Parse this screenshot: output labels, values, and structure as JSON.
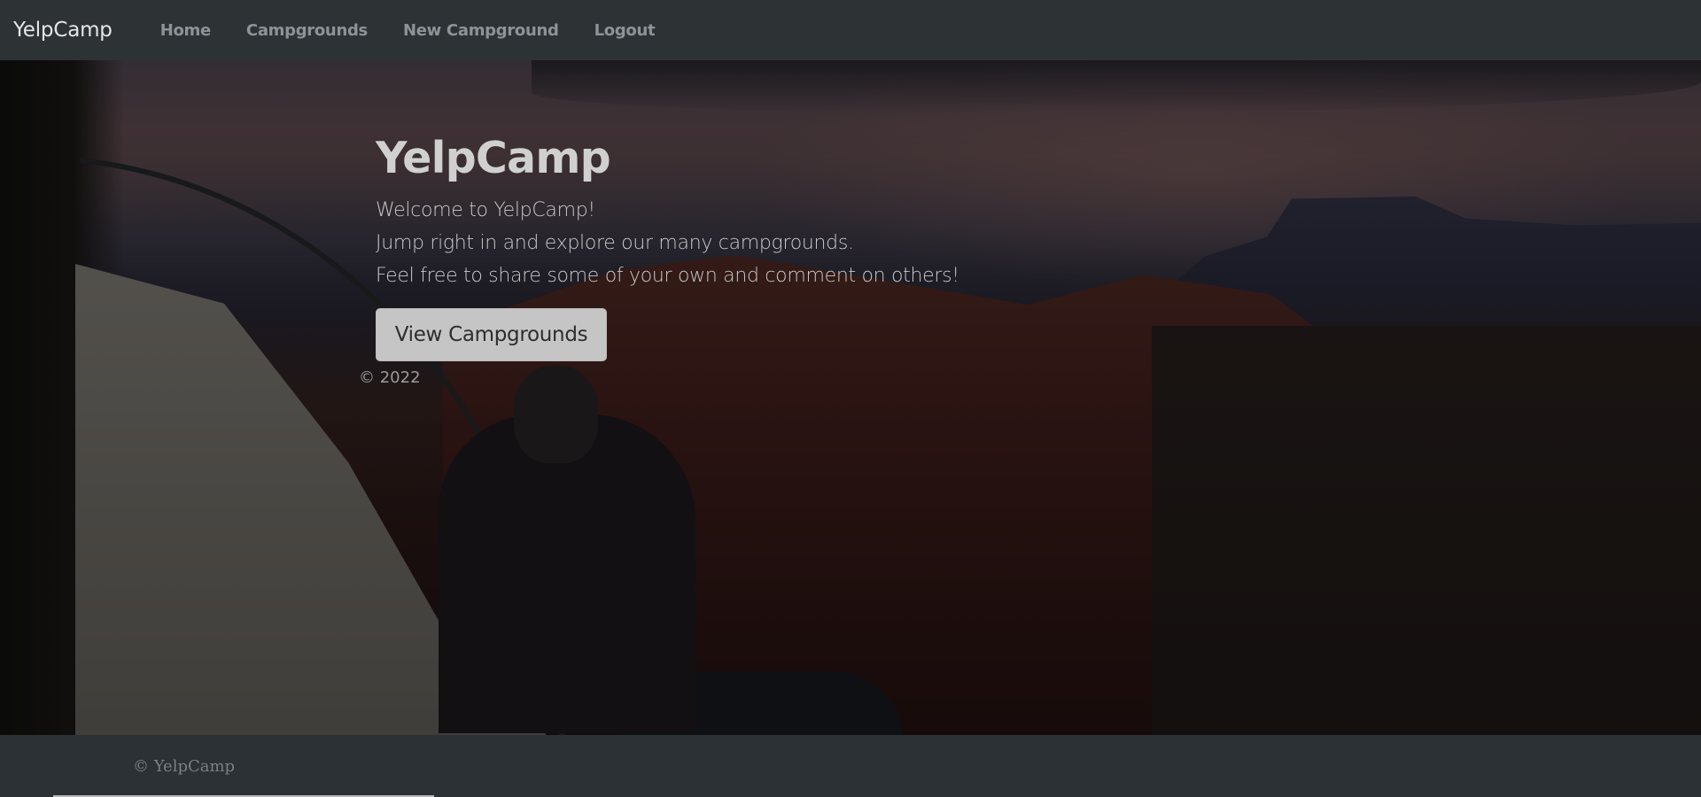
{
  "navbar": {
    "brand": "YelpCamp",
    "links": [
      {
        "label": "Home"
      },
      {
        "label": "Campgrounds"
      },
      {
        "label": "New Campground"
      },
      {
        "label": "Logout"
      }
    ]
  },
  "hero": {
    "title": "YelpCamp",
    "lines": [
      "Welcome to YelpCamp!",
      "Jump right in and explore our many campgrounds.",
      "Feel free to share some of your own and comment on others!"
    ],
    "button_label": "View Campgrounds",
    "copyright": "© 2022"
  },
  "footer": {
    "text": "© YelpCamp"
  }
}
